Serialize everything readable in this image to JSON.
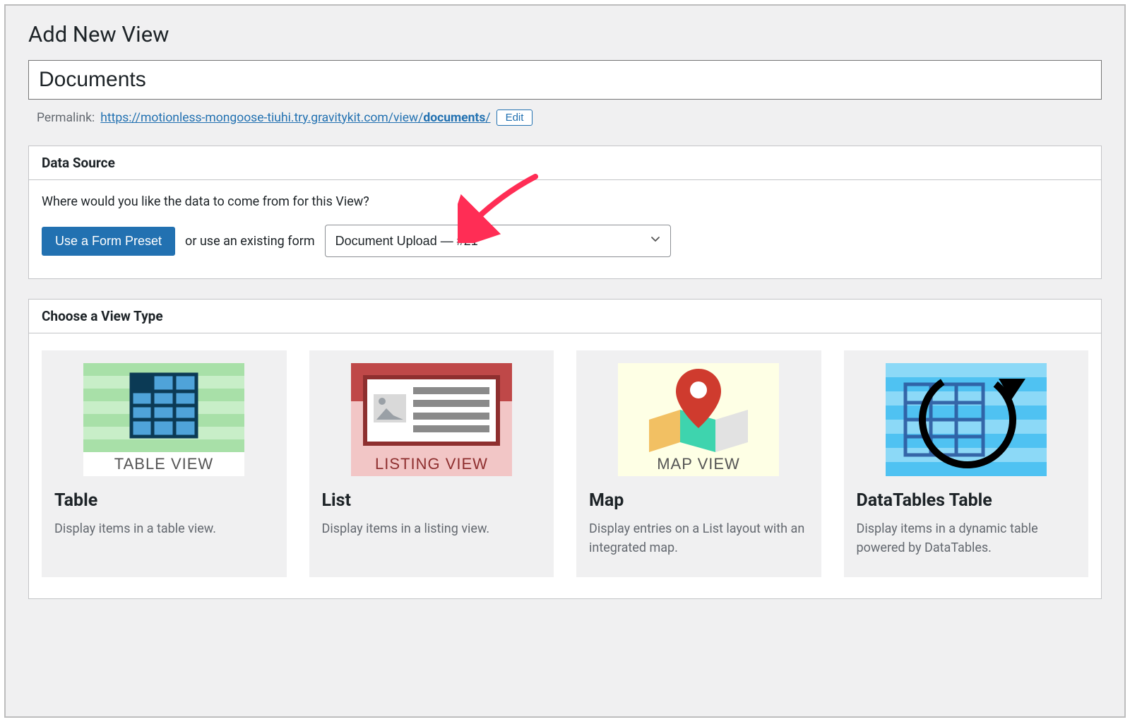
{
  "page": {
    "title": "Add New View"
  },
  "form": {
    "title_value": "Documents",
    "permalink_label": "Permalink:",
    "permalink_base": "https://motionless-mongoose-tiuhi.try.gravitykit.com/view/",
    "permalink_slug": "documents",
    "edit_label": "Edit"
  },
  "data_source": {
    "heading": "Data Source",
    "prompt": "Where would you like the data to come from for this View?",
    "preset_button": "Use a Form Preset",
    "or_text": "or use an existing form",
    "selected_form": "Document Upload — #21"
  },
  "view_type": {
    "heading": "Choose a View Type",
    "cards": [
      {
        "title": "Table",
        "desc": "Display items in a table view.",
        "thumb_label": "TABLE VIEW"
      },
      {
        "title": "List",
        "desc": "Display items in a listing view.",
        "thumb_label": "LISTING VIEW"
      },
      {
        "title": "Map",
        "desc": "Display entries on a List layout with an integrated map.",
        "thumb_label": "MAP VIEW"
      },
      {
        "title": "DataTables Table",
        "desc": "Display items in a dynamic table powered by DataTables.",
        "thumb_label": ""
      }
    ]
  }
}
